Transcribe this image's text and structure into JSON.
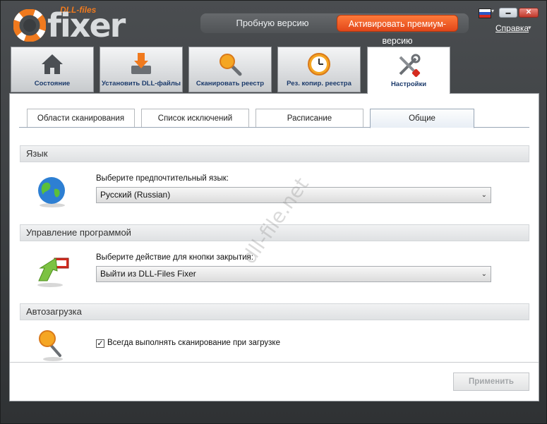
{
  "app": {
    "logo_top": "DLL-files",
    "logo_main": "fixer",
    "trial_label": "Пробную версию",
    "premium_label": "Активировать премиум-версию",
    "help_label": "Справка",
    "help_arrow": "▾",
    "flag_arrow": "▾",
    "minimize_glyph": "▬",
    "close_glyph": "✕"
  },
  "main_tabs": [
    {
      "label": "Состояние",
      "icon": "house-icon"
    },
    {
      "label": "Установить DLL-файлы",
      "icon": "download-icon"
    },
    {
      "label": "Сканировать реестр",
      "icon": "magnifier-icon"
    },
    {
      "label": "Рез. копир. реестра",
      "icon": "clock-icon"
    },
    {
      "label": "Настройки",
      "icon": "tools-icon",
      "active": true
    }
  ],
  "sub_tabs": [
    {
      "label": "Области сканирования"
    },
    {
      "label": "Список исключений"
    },
    {
      "label": "Расписание"
    },
    {
      "label": "Общие",
      "active": true
    }
  ],
  "sections": {
    "language": {
      "title": "Язык",
      "field_label": "Выберите предпочтительный язык:",
      "selected": "Русский (Russian)"
    },
    "program": {
      "title": "Управление программой",
      "field_label": "Выберите действие для кнопки закрытия:",
      "selected": "Выйти из DLL-Files Fixer"
    },
    "autorun": {
      "title": "Автозагрузка",
      "checkbox_label": "Всегда выполнять сканирование при загрузке",
      "checked": true
    }
  },
  "apply_label": "Применить",
  "watermark": "dll-file.net",
  "colors": {
    "accent": "#f07a1e",
    "premium": "#e2471a",
    "tab_text": "#1b3a6b"
  }
}
